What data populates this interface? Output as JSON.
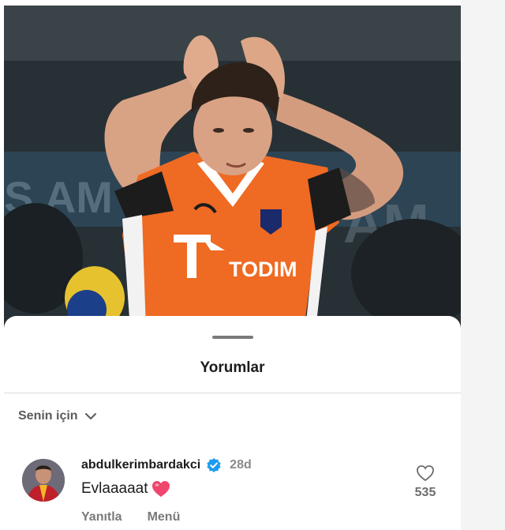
{
  "photo": {
    "sponsor_text": "TODIM",
    "subject": "football player in orange jersey with hands on head"
  },
  "sheet": {
    "title": "Yorumlar"
  },
  "filter": {
    "label": "Senin için",
    "icon": "chevron-down-icon"
  },
  "comments": [
    {
      "username": "abdulkerimbardakci",
      "verified": true,
      "age": "28d",
      "text": "Evlaaaaat",
      "emoji": "heart",
      "reply_label": "Yanıtla",
      "menu_label": "Menü",
      "like_count": "535"
    }
  ],
  "colors": {
    "jersey": "#ef6a22",
    "verified_badge": "#1d9bf0",
    "heart_emoji": "#f0456d"
  }
}
